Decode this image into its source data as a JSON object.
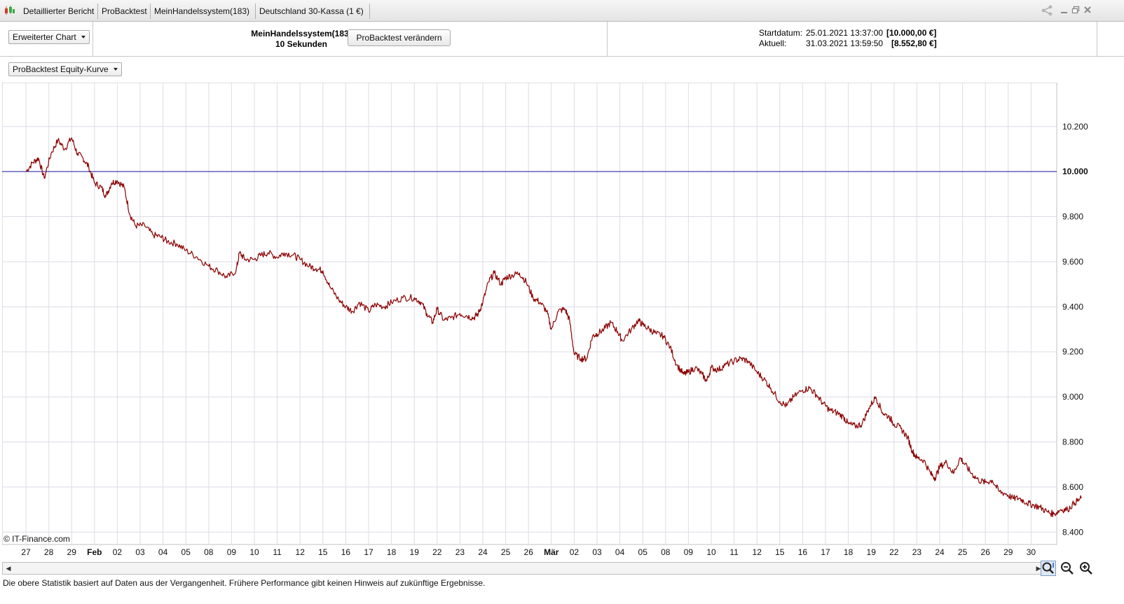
{
  "titlebar": {
    "tabs": [
      "Detaillierter Bericht",
      "ProBacktest",
      "MeinHandelssystem(183)",
      "Deutschland 30-Kassa (1 €)"
    ]
  },
  "toolbar": {
    "chart_mode": "Erweiterter Chart",
    "system_name": "MeinHandelssystem(183)",
    "interval": "10 Sekunden",
    "modify_button": "ProBacktest verändern",
    "start_label": "Startdatum:",
    "start_date": "25.01.2021 13:37:00",
    "start_value": "[10.000,00 €]",
    "current_label": "Aktuell:",
    "current_date": "31.03.2021 13:59:50",
    "current_value": "[8.552,80 €]"
  },
  "equity_selector": "ProBacktest Equity-Kurve",
  "copyright": "© IT-Finance.com",
  "footer": "Die obere Statistik basiert auf Daten aus der Vergangenheit. Frühere Performance gibt keinen Hinweis auf zukünftige Ergebnisse.",
  "colors": {
    "equity_line": "#8b0000",
    "baseline": "#1a1aa6",
    "grid": "#dcdce6"
  },
  "chart_data": {
    "type": "line",
    "title": "",
    "xlabel": "",
    "ylabel": "",
    "y_ticks": [
      "10.200",
      "10.000",
      "9.800",
      "9.600",
      "9.400",
      "9.200",
      "9.000",
      "8.800",
      "8.600",
      "8.400"
    ],
    "y_tick_values": [
      10200,
      10000,
      9800,
      9600,
      9400,
      9200,
      9000,
      8800,
      8600,
      8400
    ],
    "emphasized_tick": "10.000",
    "ylim": [
      8345,
      10395
    ],
    "baseline": 10000,
    "x_labels": [
      "27",
      "28",
      "29",
      "Feb",
      "02",
      "03",
      "04",
      "05",
      "08",
      "09",
      "10",
      "11",
      "12",
      "15",
      "16",
      "17",
      "18",
      "19",
      "22",
      "23",
      "24",
      "25",
      "26",
      "Mär",
      "02",
      "03",
      "04",
      "05",
      "08",
      "09",
      "10",
      "11",
      "12",
      "15",
      "16",
      "17",
      "18",
      "19",
      "22",
      "23",
      "24",
      "25",
      "26",
      "29",
      "30"
    ],
    "bold_labels": [
      "Feb",
      "Mär"
    ],
    "x_index_range": [
      0,
      46
    ],
    "series": [
      {
        "values": [
          [
            0,
            10000
          ],
          [
            0.3,
            10040
          ],
          [
            0.55,
            10060
          ],
          [
            0.8,
            9970
          ],
          [
            1.1,
            10080
          ],
          [
            1.4,
            10140
          ],
          [
            1.7,
            10100
          ],
          [
            2.0,
            10150
          ],
          [
            2.25,
            10080
          ],
          [
            2.5,
            10060
          ],
          [
            2.75,
            10020
          ],
          [
            3.0,
            9950
          ],
          [
            3.3,
            9930
          ],
          [
            3.5,
            9890
          ],
          [
            3.75,
            9950
          ],
          [
            4.0,
            9960
          ],
          [
            4.3,
            9930
          ],
          [
            4.55,
            9810
          ],
          [
            4.8,
            9760
          ],
          [
            5.2,
            9760
          ],
          [
            5.55,
            9720
          ],
          [
            5.9,
            9710
          ],
          [
            6.2,
            9690
          ],
          [
            6.6,
            9680
          ],
          [
            7.0,
            9650
          ],
          [
            7.5,
            9620
          ],
          [
            8.0,
            9580
          ],
          [
            8.4,
            9560
          ],
          [
            8.8,
            9530
          ],
          [
            9.2,
            9560
          ],
          [
            9.35,
            9640
          ],
          [
            9.6,
            9610
          ],
          [
            10.0,
            9610
          ],
          [
            10.3,
            9630
          ],
          [
            10.6,
            9640
          ],
          [
            11.0,
            9620
          ],
          [
            11.3,
            9640
          ],
          [
            11.7,
            9630
          ],
          [
            12.0,
            9610
          ],
          [
            12.4,
            9580
          ],
          [
            12.7,
            9570
          ],
          [
            13.0,
            9560
          ],
          [
            13.3,
            9490
          ],
          [
            13.7,
            9430
          ],
          [
            14.0,
            9400
          ],
          [
            14.3,
            9380
          ],
          [
            14.6,
            9420
          ],
          [
            15.0,
            9380
          ],
          [
            15.3,
            9410
          ],
          [
            15.7,
            9400
          ],
          [
            16.0,
            9420
          ],
          [
            16.5,
            9440
          ],
          [
            17.0,
            9440
          ],
          [
            17.3,
            9420
          ],
          [
            17.55,
            9370
          ],
          [
            17.8,
            9330
          ],
          [
            18.0,
            9390
          ],
          [
            18.3,
            9340
          ],
          [
            18.6,
            9350
          ],
          [
            19.0,
            9370
          ],
          [
            19.3,
            9360
          ],
          [
            19.6,
            9350
          ],
          [
            19.8,
            9370
          ],
          [
            20.0,
            9420
          ],
          [
            20.25,
            9510
          ],
          [
            20.5,
            9550
          ],
          [
            20.8,
            9500
          ],
          [
            21.0,
            9530
          ],
          [
            21.3,
            9540
          ],
          [
            21.6,
            9550
          ],
          [
            21.9,
            9510
          ],
          [
            22.2,
            9440
          ],
          [
            22.5,
            9420
          ],
          [
            22.8,
            9380
          ],
          [
            23.0,
            9300
          ],
          [
            23.3,
            9380
          ],
          [
            23.6,
            9390
          ],
          [
            23.8,
            9340
          ],
          [
            24.0,
            9190
          ],
          [
            24.3,
            9170
          ],
          [
            24.55,
            9170
          ],
          [
            24.8,
            9270
          ],
          [
            25.0,
            9280
          ],
          [
            25.3,
            9300
          ],
          [
            25.6,
            9330
          ],
          [
            25.9,
            9290
          ],
          [
            26.1,
            9250
          ],
          [
            26.5,
            9300
          ],
          [
            26.8,
            9340
          ],
          [
            27.0,
            9320
          ],
          [
            27.3,
            9300
          ],
          [
            27.6,
            9280
          ],
          [
            27.9,
            9270
          ],
          [
            28.2,
            9220
          ],
          [
            28.5,
            9140
          ],
          [
            28.8,
            9100
          ],
          [
            29.0,
            9110
          ],
          [
            29.3,
            9130
          ],
          [
            29.6,
            9100
          ],
          [
            29.8,
            9070
          ],
          [
            30.0,
            9130
          ],
          [
            30.3,
            9120
          ],
          [
            30.6,
            9140
          ],
          [
            31.0,
            9160
          ],
          [
            31.3,
            9170
          ],
          [
            31.6,
            9160
          ],
          [
            32.0,
            9110
          ],
          [
            32.3,
            9080
          ],
          [
            32.6,
            9040
          ],
          [
            33.0,
            8980
          ],
          [
            33.3,
            8960
          ],
          [
            33.6,
            9000
          ],
          [
            34.0,
            9030
          ],
          [
            34.3,
            9040
          ],
          [
            34.6,
            9010
          ],
          [
            34.9,
            8970
          ],
          [
            35.2,
            8940
          ],
          [
            35.5,
            8930
          ],
          [
            35.8,
            8910
          ],
          [
            36.0,
            8880
          ],
          [
            36.3,
            8870
          ],
          [
            36.6,
            8880
          ],
          [
            36.9,
            8950
          ],
          [
            37.2,
            9000
          ],
          [
            37.5,
            8930
          ],
          [
            37.8,
            8910
          ],
          [
            38.0,
            8880
          ],
          [
            38.3,
            8860
          ],
          [
            38.6,
            8820
          ],
          [
            38.8,
            8760
          ],
          [
            39.0,
            8730
          ],
          [
            39.3,
            8720
          ],
          [
            39.6,
            8660
          ],
          [
            39.8,
            8640
          ],
          [
            40.0,
            8690
          ],
          [
            40.3,
            8710
          ],
          [
            40.6,
            8660
          ],
          [
            40.9,
            8730
          ],
          [
            41.1,
            8700
          ],
          [
            41.4,
            8660
          ],
          [
            41.7,
            8630
          ],
          [
            42.0,
            8620
          ],
          [
            42.3,
            8630
          ],
          [
            42.6,
            8580
          ],
          [
            42.9,
            8570
          ],
          [
            43.2,
            8550
          ],
          [
            43.5,
            8550
          ],
          [
            43.8,
            8530
          ],
          [
            44.1,
            8520
          ],
          [
            44.4,
            8510
          ],
          [
            44.7,
            8490
          ],
          [
            45.0,
            8480
          ],
          [
            45.3,
            8500
          ],
          [
            45.6,
            8500
          ],
          [
            45.9,
            8530
          ],
          [
            46.2,
            8550
          ]
        ]
      }
    ]
  }
}
